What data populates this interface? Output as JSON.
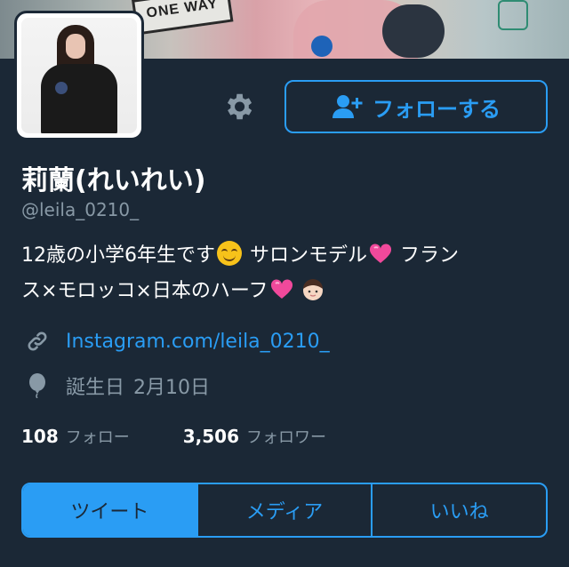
{
  "banner": {
    "sign_text": "ONE WAY"
  },
  "follow_button": {
    "label": "フォローする"
  },
  "profile": {
    "name": "莉蘭(れいれい)",
    "handle": "@leila_0210_",
    "bio_line1_a": "12歳の小学6年生です",
    "bio_line1_b": " サロンモデル",
    "bio_line1_c": "  フラン",
    "bio_line2_a": "ス×モロッコ×日本のハーフ",
    "link": "Instagram.com/leila_0210_",
    "birthday_label": "誕生日",
    "birthday_value": "2月10日"
  },
  "stats": {
    "following_count": "108",
    "following_label": "フォロー",
    "followers_count": "3,506",
    "followers_label": "フォロワー"
  },
  "tabs": [
    {
      "label": "ツイート",
      "active": true
    },
    {
      "label": "メディア",
      "active": false
    },
    {
      "label": "いいね",
      "active": false
    }
  ],
  "colors": {
    "background": "#1b2836",
    "accent": "#2a9df4",
    "secondary_text": "#8899a6"
  },
  "icons": {
    "settings": "gear-icon",
    "follow": "add-user-icon",
    "link": "link-icon",
    "birthday": "balloon-icon"
  }
}
